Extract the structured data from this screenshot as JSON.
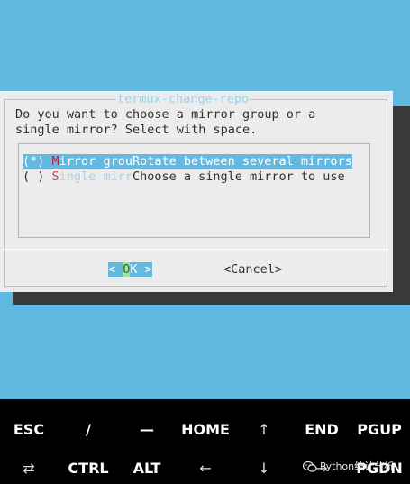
{
  "dialog": {
    "title": "termux-change-repo",
    "prompt_line1": "Do you want to choose a mirror group or a",
    "prompt_line2": "single mirror? Select with space.",
    "options": [
      {
        "radio": "(*)",
        "hotkey": "M",
        "name_rest": "irror grou",
        "description": "Rotate between several mirrors",
        "selected": true
      },
      {
        "radio": "( )",
        "hotkey": "S",
        "name_rest": "ingle mirr",
        "description": "Choose a single mirror to use",
        "selected": false
      }
    ],
    "ok_button": {
      "left": "< ",
      "hotkey": "O",
      "rest": "K >"
    },
    "cancel_button": "<Cancel>"
  },
  "keyboard": {
    "row1": [
      "ESC",
      "/",
      "—",
      "HOME",
      "↑",
      "END",
      "PGUP"
    ],
    "row2": [
      "⇄",
      "CTRL",
      "ALT",
      "←",
      "↓",
      "→",
      "PGDN"
    ]
  },
  "watermark": {
    "text": "Python统计分析",
    "icon": "wechat-icon"
  },
  "colors": {
    "terminal_bg": "#5fb9e0",
    "dialog_bg": "#ececec",
    "highlight": "#64b9e2",
    "shadow": "#393939",
    "hotkey": "#d23f6d"
  }
}
